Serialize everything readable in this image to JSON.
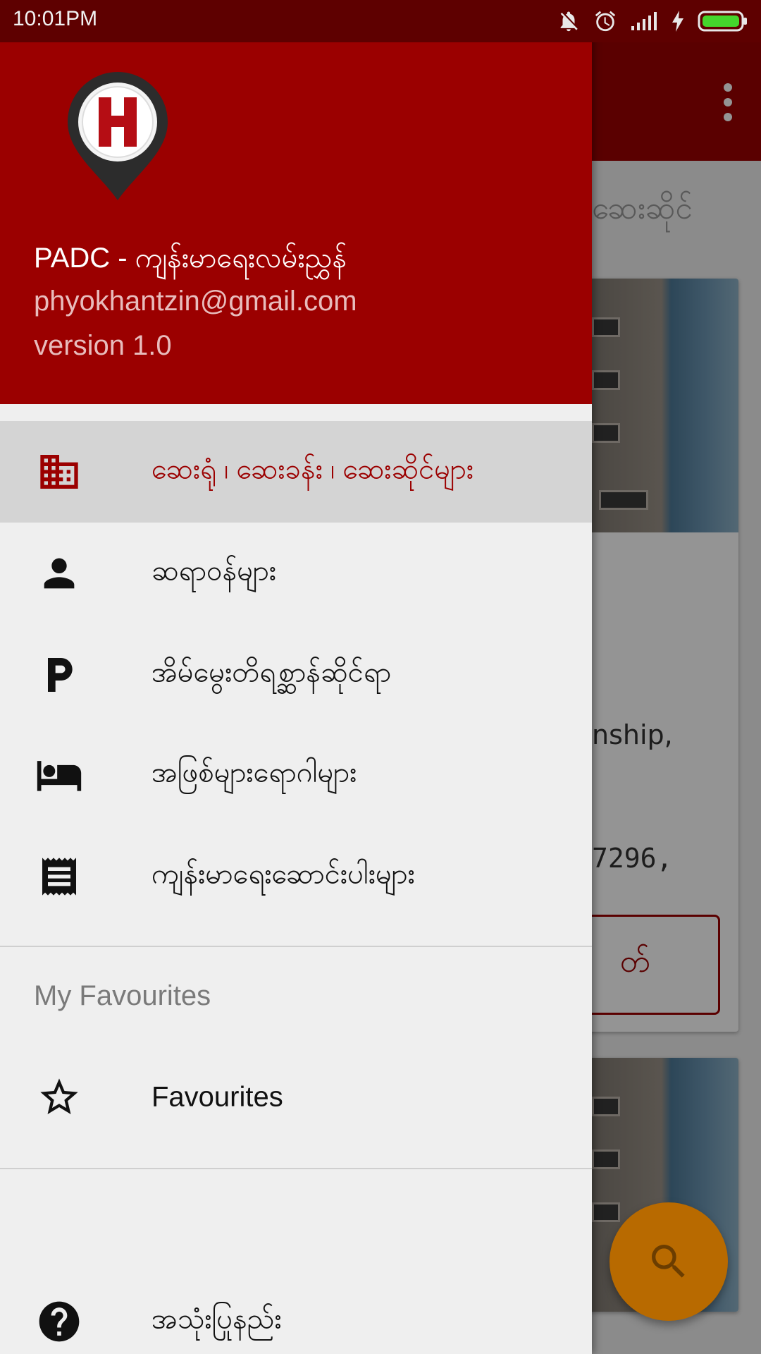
{
  "status_bar": {
    "time": "10:01PM",
    "icons": [
      "mute-icon",
      "alarm-icon",
      "signal-icon",
      "charging-icon",
      "battery-icon"
    ]
  },
  "background": {
    "subtitle": "ဆေးဆိုင်",
    "card_text_1": "nship,",
    "card_text_2": "7296,",
    "card_button": "တ်"
  },
  "drawer": {
    "header": {
      "title": "PADC - ကျန်းမာရေးလမ်းညွှန်",
      "email": "phyokhantzin@gmail.com",
      "version": "version 1.0"
    },
    "items": [
      {
        "label": "ဆေးရုံ ၊ ဆေးခန်း ၊ ဆေးဆိုင်များ",
        "icon": "building-icon",
        "active": true
      },
      {
        "label": "ဆရာဝန်များ",
        "icon": "person-icon",
        "active": false
      },
      {
        "label": "အိမ်မွေးတိရစ္ဆာန်ဆိုင်ရာ",
        "icon": "parking-icon",
        "active": false
      },
      {
        "label": "အဖြစ်များရောဂါများ",
        "icon": "bed-icon",
        "active": false
      },
      {
        "label": "ကျန်းမာရေးဆောင်းပါးများ",
        "icon": "receipt-icon",
        "active": false
      }
    ],
    "favourites_header": "My Favourites",
    "favourites_item": {
      "label": "Favourites",
      "icon": "star-outline-icon"
    },
    "help_item": {
      "label": "အသုံးပြုနည်း",
      "icon": "help-icon"
    }
  },
  "colors": {
    "primary": "#9b0000",
    "status_bar": "#5e0000",
    "drawer_bg": "#efefef",
    "active_item_bg": "#d4d4d4",
    "fab": "#b86a00"
  }
}
